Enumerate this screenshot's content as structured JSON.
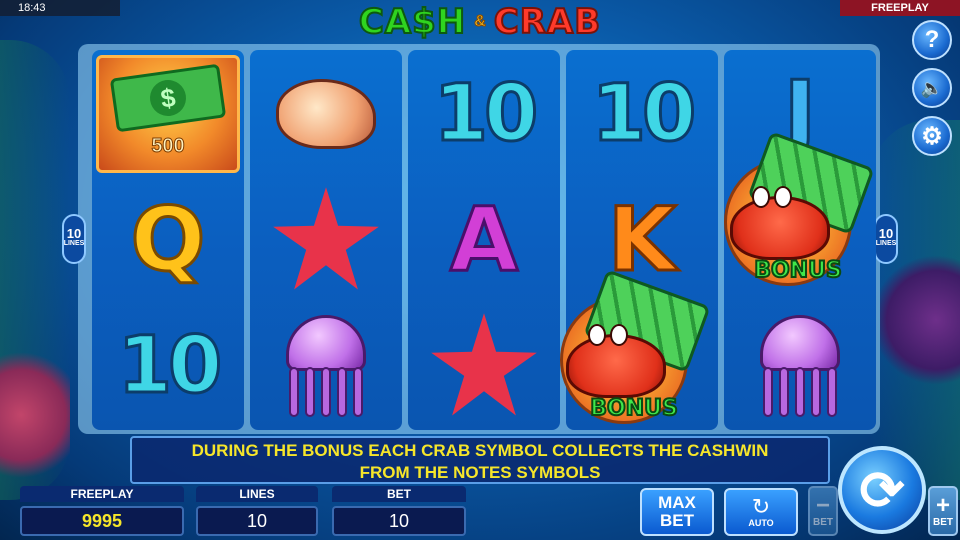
{
  "status": {
    "time": "18:43",
    "mode": "FREEPLAY"
  },
  "logo": {
    "word1": "CA$H",
    "amp": "&",
    "word2": "CRAB"
  },
  "lines_badge": {
    "count": "10",
    "label": "LINES"
  },
  "reels": [
    [
      {
        "type": "cash",
        "value": "500"
      },
      {
        "type": "letter",
        "text": "Q",
        "cls": "letter-q"
      },
      {
        "type": "ten",
        "text": "10"
      }
    ],
    [
      {
        "type": "shell"
      },
      {
        "type": "starfish"
      },
      {
        "type": "jellyfish"
      }
    ],
    [
      {
        "type": "ten",
        "text": "10"
      },
      {
        "type": "letter",
        "text": "A",
        "cls": "letter-a"
      },
      {
        "type": "starfish"
      }
    ],
    [
      {
        "type": "ten",
        "text": "10"
      },
      {
        "type": "letter",
        "text": "K",
        "cls": "letter-k"
      },
      {
        "type": "blank"
      }
    ],
    [
      {
        "type": "letter",
        "text": "J",
        "cls": "letter-j"
      },
      {
        "type": "blank"
      },
      {
        "type": "jellyfish"
      }
    ]
  ],
  "bonus_label": "BONUS",
  "info": {
    "line1": "DURING THE BONUS EACH CRAB SYMBOL COLLECTS THE CASHWIN",
    "line2": "FROM THE NOTES SYMBOLS"
  },
  "panels": {
    "freeplay": {
      "title": "FREEPLAY",
      "value": "9995"
    },
    "lines": {
      "title": "LINES",
      "value": "10"
    },
    "bet": {
      "title": "BET",
      "value": "10"
    }
  },
  "buttons": {
    "max_bet_line1": "MAX",
    "max_bet_line2": "BET",
    "auto_label": "AUTO",
    "bet_minus_sign": "−",
    "bet_plus_sign": "+",
    "bet_label": "BET",
    "spin_glyph": "⟳",
    "help_glyph": "?",
    "sound_glyph": "🔈",
    "settings_glyph": "⚙"
  },
  "colors": {
    "mode_bg": "#8d1424",
    "info_text": "#f6e62a",
    "bonus_text": "#3fe84a"
  },
  "icons": [
    "help-icon",
    "sound-muted-icon",
    "settings-icon",
    "spin-icon",
    "auto-play-icon"
  ]
}
